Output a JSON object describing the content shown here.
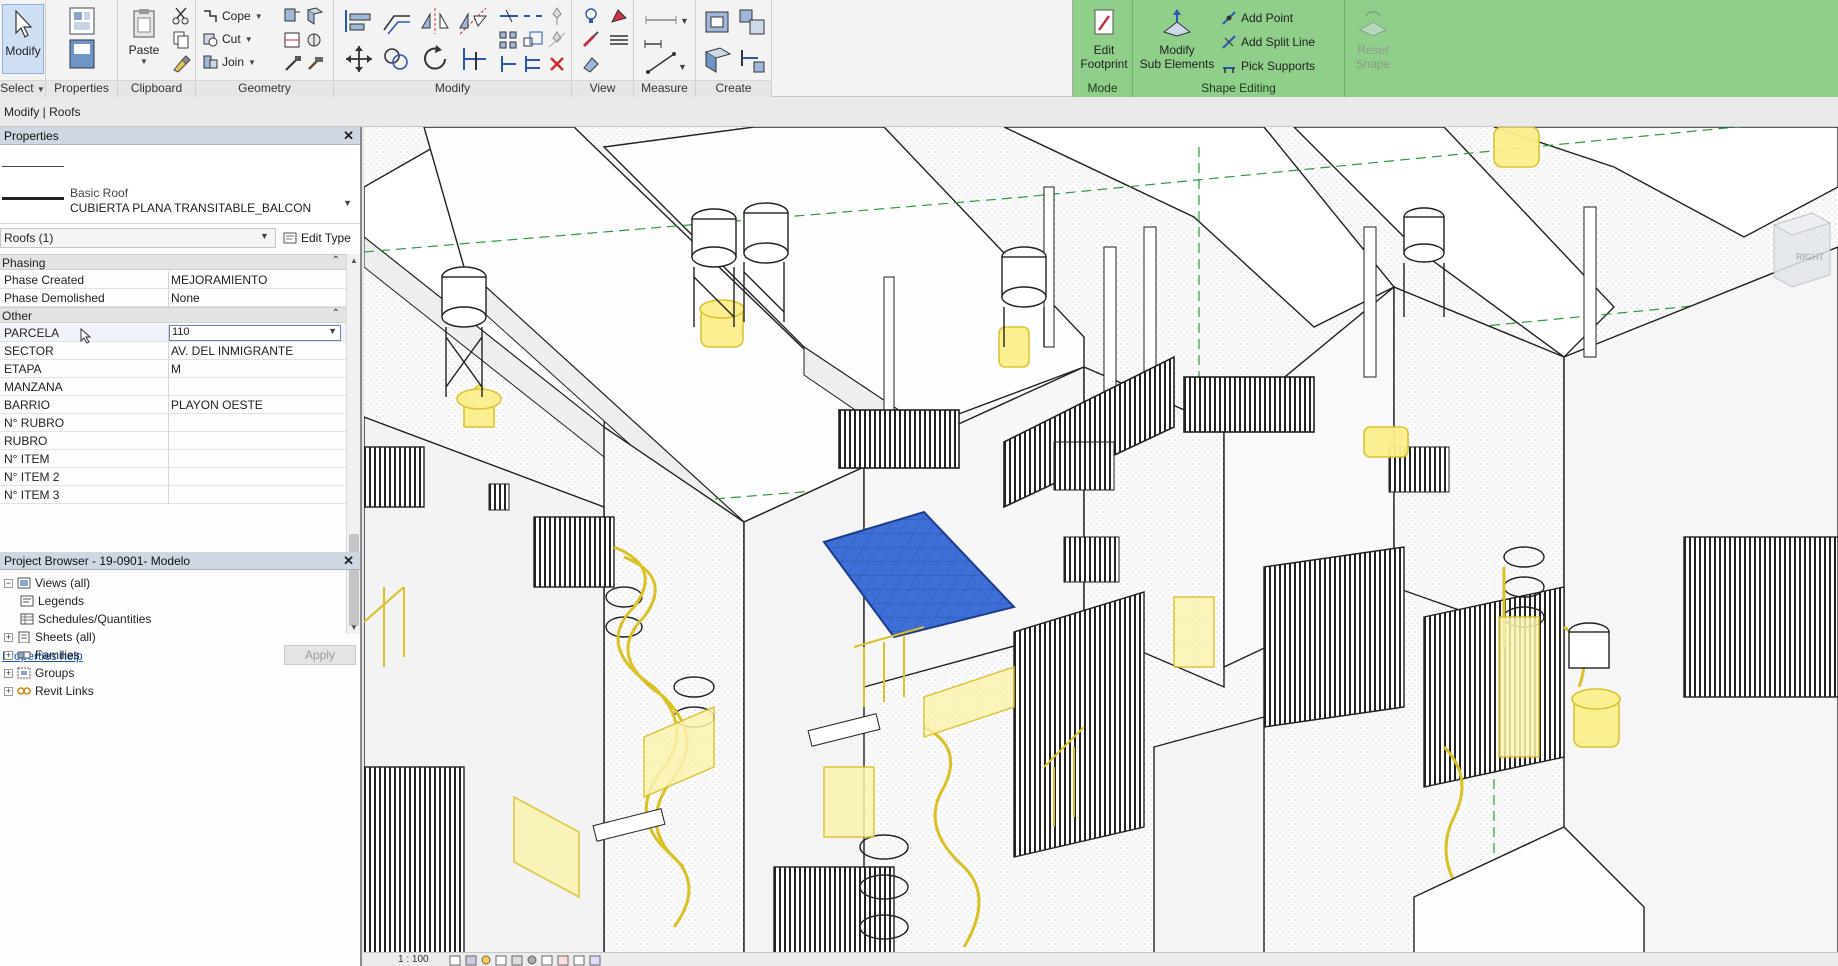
{
  "ribbon": {
    "groups": {
      "select": "Select",
      "properties": "Properties",
      "clipboard": "Clipboard",
      "geometry": "Geometry",
      "modify": "Modify",
      "view": "View",
      "measure": "Measure",
      "create": "Create",
      "mode": "Mode",
      "shape_editing": "Shape Editing"
    },
    "modify_label": "Modify",
    "paste_label": "Paste",
    "cope_label": "Cope",
    "cut_label": "Cut",
    "join_label": "Join",
    "edit_footprint_line1": "Edit",
    "edit_footprint_line2": "Footprint",
    "modify_sub_line1": "Modify",
    "modify_sub_line2": "Sub Elements",
    "add_point": "Add Point",
    "add_split_line": "Add Split Line",
    "pick_supports": "Pick Supports",
    "reset_shape_line1": "Reset",
    "reset_shape_line2": "Shape",
    "accent_green": "#8fcf8a"
  },
  "context_bar": {
    "label": "Modify | Roofs"
  },
  "properties": {
    "title": "Properties",
    "type_family": "Basic Roof",
    "type_name": "CUBIERTA PLANA TRANSITABLE_BALCON",
    "instance_selector": "Roofs (1)",
    "edit_type": "Edit Type",
    "sections": {
      "phasing": "Phasing",
      "other": "Other"
    },
    "phasing_rows": [
      {
        "name": "Phase Created",
        "value": "MEJORAMIENTO"
      },
      {
        "name": "Phase Demolished",
        "value": "None"
      }
    ],
    "other_rows": [
      {
        "name": "PARCELA",
        "value": "110"
      },
      {
        "name": "SECTOR",
        "value": "AV. DEL INMIGRANTE"
      },
      {
        "name": "ETAPA",
        "value": "M"
      },
      {
        "name": "MANZANA",
        "value": ""
      },
      {
        "name": "BARRIO",
        "value": "PLAYON OESTE"
      },
      {
        "name": "N° RUBRO",
        "value": ""
      },
      {
        "name": "RUBRO",
        "value": ""
      },
      {
        "name": "N° ITEM",
        "value": ""
      },
      {
        "name": "N° ITEM 2",
        "value": ""
      },
      {
        "name": "N° ITEM 3",
        "value": ""
      }
    ],
    "help_link": "Properties help",
    "apply": "Apply"
  },
  "project_browser": {
    "title": "Project Browser - 19-0901- Modelo",
    "items": [
      {
        "label": "Views (all)",
        "expand": "−"
      },
      {
        "label": "Legends",
        "expand": ""
      },
      {
        "label": "Schedules/Quantities",
        "expand": ""
      },
      {
        "label": "Sheets (all)",
        "expand": "+"
      },
      {
        "label": "Families",
        "expand": "+"
      },
      {
        "label": "Groups",
        "expand": "+"
      },
      {
        "label": "Revit Links",
        "expand": "+"
      }
    ]
  },
  "viewport": {
    "scale": "1 : 100",
    "view_cube_label": "RIGHT",
    "selection_color": "#3e6fd6",
    "highlight_color": "#f2e24a"
  }
}
